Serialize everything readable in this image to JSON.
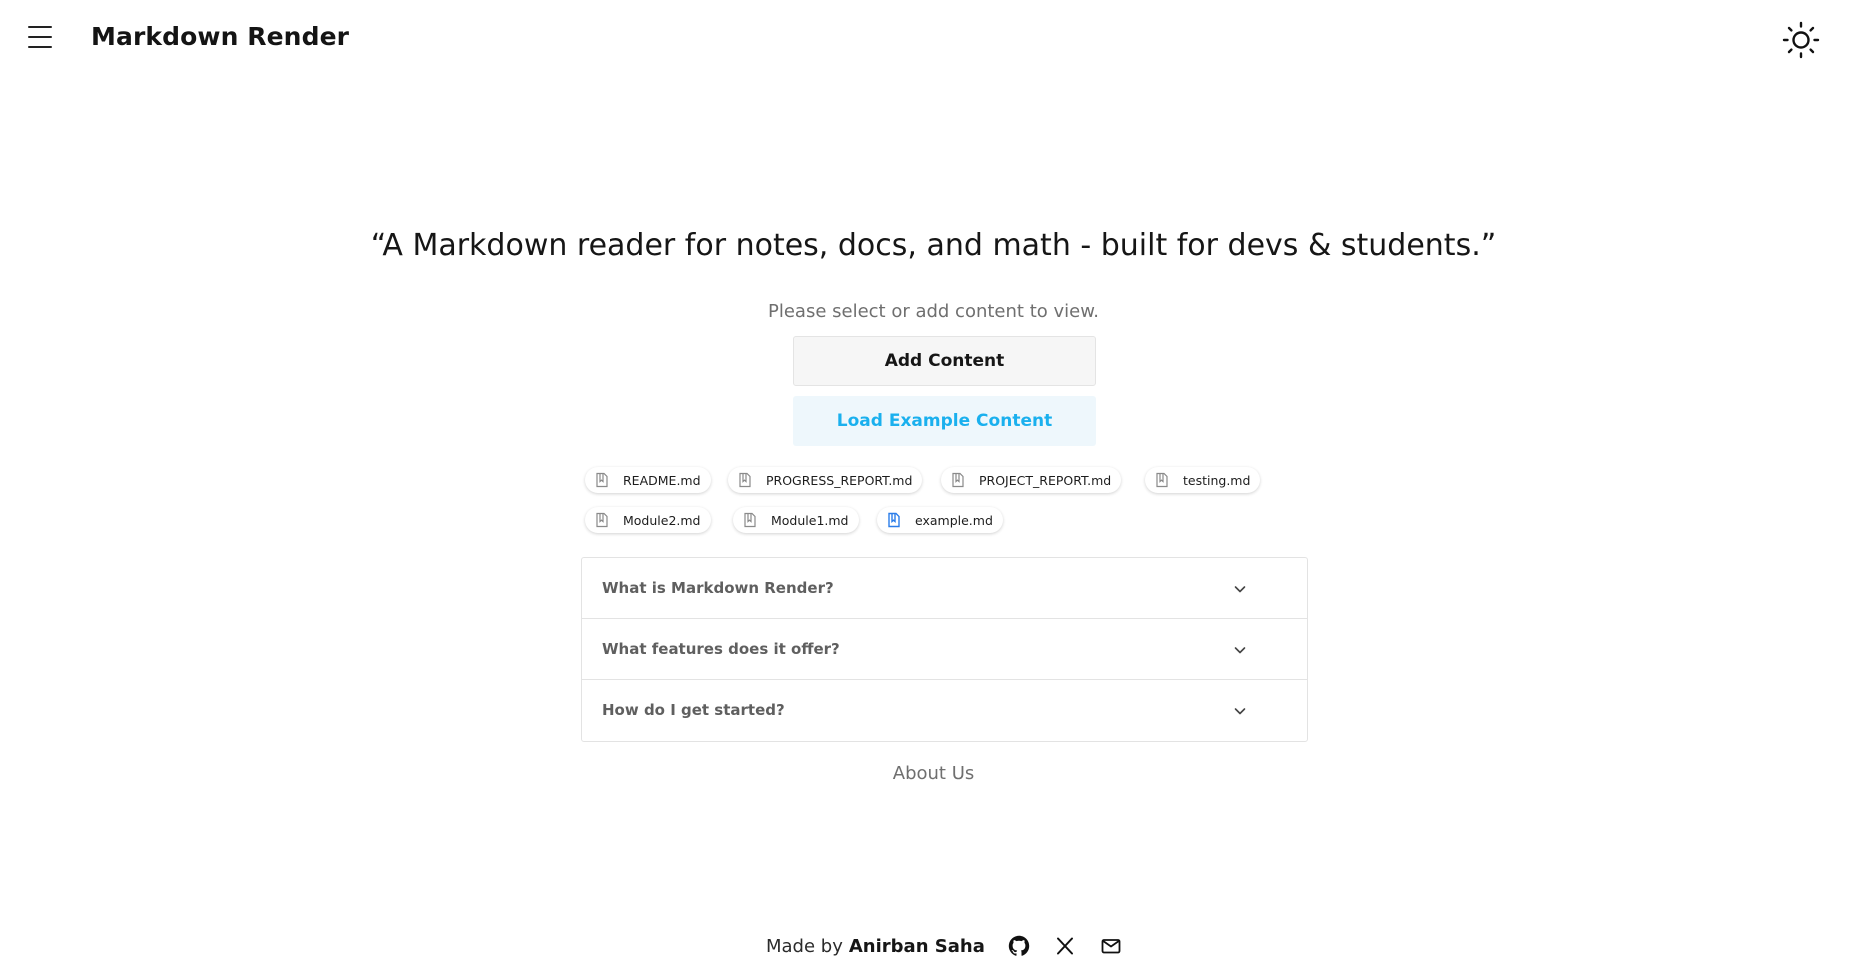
{
  "header": {
    "app_title": "Markdown Render",
    "menu_icon": "hamburger-menu-icon",
    "theme_icon": "sun-icon"
  },
  "main": {
    "tagline": "“A Markdown reader for notes, docs, and math - built for devs & students.”",
    "prompt": "Please select or add content to view.",
    "add_content_label": "Add Content",
    "load_example_label": "Load Example Content",
    "files": [
      {
        "name": "README.md",
        "icon": "file-icon",
        "active": false
      },
      {
        "name": "PROGRESS_REPORT.md",
        "icon": "file-icon",
        "active": false
      },
      {
        "name": "PROJECT_REPORT.md",
        "icon": "file-icon",
        "active": false
      },
      {
        "name": "testing.md",
        "icon": "file-icon",
        "active": false
      },
      {
        "name": "Module2.md",
        "icon": "file-icon",
        "active": false
      },
      {
        "name": "Module1.md",
        "icon": "file-icon",
        "active": false
      },
      {
        "name": "example.md",
        "icon": "file-icon",
        "active": true
      }
    ],
    "faq": [
      {
        "question": "What is Markdown Render?"
      },
      {
        "question": "What features does it offer?"
      },
      {
        "question": "How do I get started?"
      }
    ],
    "about_link": "About Us"
  },
  "footer": {
    "made_by": "Made by",
    "author": "Anirban Saha",
    "icons": [
      "github-icon",
      "x-twitter-icon",
      "mail-icon"
    ]
  },
  "colors": {
    "accent": "#1ab0ee",
    "accent_bg": "#eef7fc",
    "active_file_icon": "#2b7de9",
    "muted_text": "#6f6f6f"
  }
}
